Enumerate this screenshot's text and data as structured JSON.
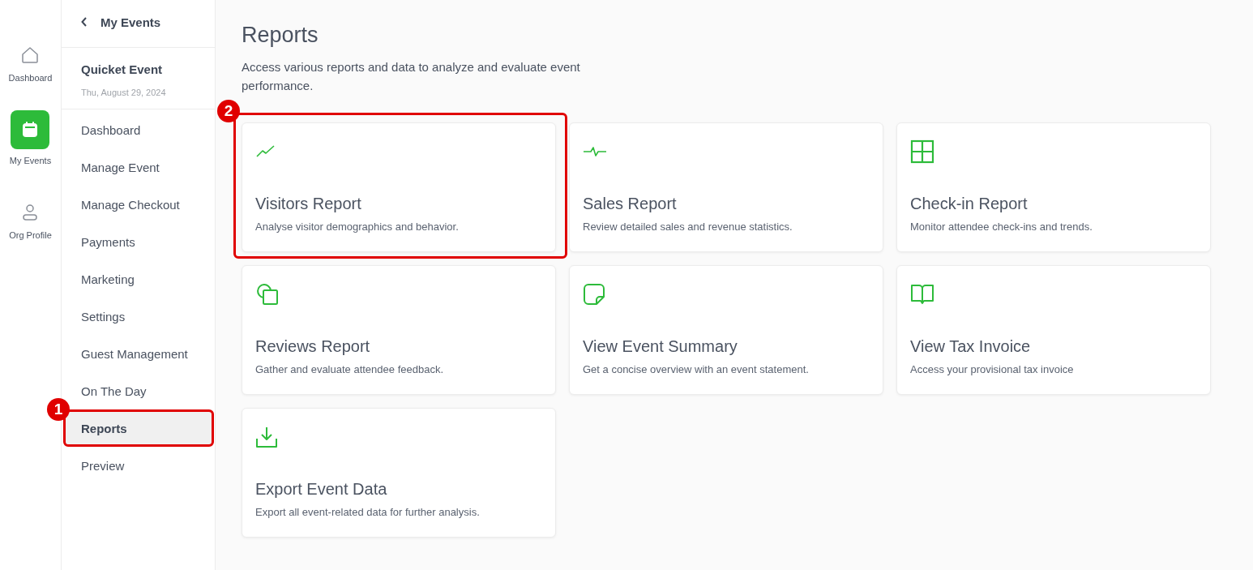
{
  "rail": [
    {
      "label": "Dashboard",
      "selected": false
    },
    {
      "label": "My Events",
      "selected": true
    },
    {
      "label": "Org Profile",
      "selected": false
    }
  ],
  "sidebar": {
    "back_label": "My Events",
    "event_name": "Quicket Event",
    "event_date": "Thu, August 29, 2024",
    "items": [
      {
        "label": "Dashboard",
        "selected": false
      },
      {
        "label": "Manage Event",
        "selected": false
      },
      {
        "label": "Manage Checkout",
        "selected": false
      },
      {
        "label": "Payments",
        "selected": false
      },
      {
        "label": "Marketing",
        "selected": false
      },
      {
        "label": "Settings",
        "selected": false
      },
      {
        "label": "Guest Management",
        "selected": false
      },
      {
        "label": "On The Day",
        "selected": false
      },
      {
        "label": "Reports",
        "selected": true,
        "callout": "1"
      },
      {
        "label": "Preview",
        "selected": false
      }
    ]
  },
  "page": {
    "title": "Reports",
    "subtitle": "Access various reports and data to analyze and evaluate event performance."
  },
  "cards": [
    {
      "title": "Visitors Report",
      "description": "Analyse visitor demographics and behavior.",
      "callout": "2"
    },
    {
      "title": "Sales Report",
      "description": "Review detailed sales and revenue statistics."
    },
    {
      "title": "Check-in Report",
      "description": "Monitor attendee check-ins and trends."
    },
    {
      "title": "Reviews Report",
      "description": "Gather and evaluate attendee feedback."
    },
    {
      "title": "View Event Summary",
      "description": "Get a concise overview with an event statement."
    },
    {
      "title": "View Tax Invoice",
      "description": "Access your provisional tax invoice"
    },
    {
      "title": "Export Event Data",
      "description": "Export all event-related data for further analysis."
    }
  ]
}
